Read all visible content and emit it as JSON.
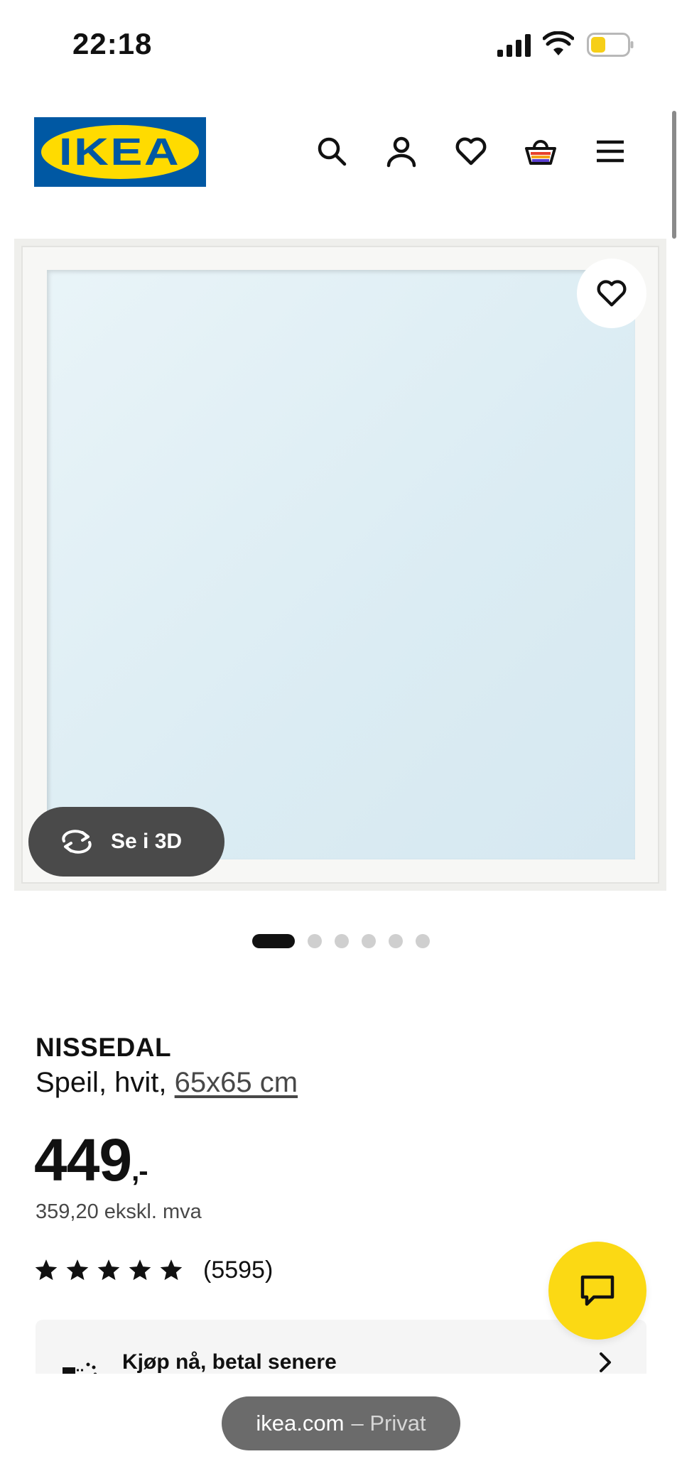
{
  "status_bar": {
    "time": "22:18",
    "icons": [
      "signal-icon",
      "wifi-icon",
      "battery-icon"
    ],
    "battery_color": "#f6cf18"
  },
  "header": {
    "logo_text": "IKEA",
    "icons": [
      "search-icon",
      "account-icon",
      "heart-icon",
      "basket-icon",
      "menu-icon"
    ],
    "brand_blue": "#0058a3",
    "brand_yellow": "#ffdb00"
  },
  "gallery": {
    "view_3d_label": "Se i 3D",
    "dot_count": 6,
    "active_dot": 0
  },
  "product": {
    "name": "NISSEDAL",
    "description": "Speil, hvit, ",
    "size_link": "65x65 cm",
    "price": "449",
    "price_suffix": ",-",
    "price_ex_vat": "359,20 ekskl. mva",
    "rating_stars": 5,
    "rating_count": "(5595)"
  },
  "financing": {
    "label": "Kjøp nå, betal senere"
  },
  "chat": {
    "color": "#fbd914"
  },
  "browser": {
    "domain": "ikea.com",
    "mode": "– Privat"
  }
}
